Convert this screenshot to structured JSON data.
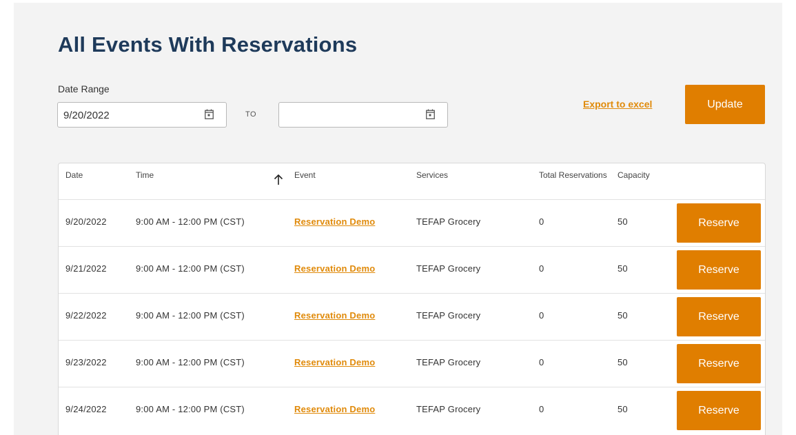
{
  "page_title": "All Events With Reservations",
  "date_range": {
    "label": "Date Range",
    "start_value": "9/20/2022",
    "to_label": "TO",
    "end_value": ""
  },
  "actions": {
    "export_label": "Export to excel",
    "update_label": "Update"
  },
  "table": {
    "headers": {
      "date": "Date",
      "time": "Time",
      "event": "Event",
      "services": "Services",
      "total_reservations": "Total Reservations",
      "capacity": "Capacity"
    },
    "sort_icon": "arrow-up-icon",
    "rows": [
      {
        "date": "9/20/2022",
        "time": "9:00 AM - 12:00 PM (CST)",
        "event": "Reservation Demo",
        "services": "TEFAP Grocery",
        "total": "0",
        "capacity": "50",
        "action": "Reserve"
      },
      {
        "date": "9/21/2022",
        "time": "9:00 AM - 12:00 PM (CST)",
        "event": "Reservation Demo",
        "services": "TEFAP Grocery",
        "total": "0",
        "capacity": "50",
        "action": "Reserve"
      },
      {
        "date": "9/22/2022",
        "time": "9:00 AM - 12:00 PM (CST)",
        "event": "Reservation Demo",
        "services": "TEFAP Grocery",
        "total": "0",
        "capacity": "50",
        "action": "Reserve"
      },
      {
        "date": "9/23/2022",
        "time": "9:00 AM - 12:00 PM (CST)",
        "event": "Reservation Demo",
        "services": "TEFAP Grocery",
        "total": "0",
        "capacity": "50",
        "action": "Reserve"
      },
      {
        "date": "9/24/2022",
        "time": "9:00 AM - 12:00 PM (CST)",
        "event": "Reservation Demo",
        "services": "TEFAP Grocery",
        "total": "0",
        "capacity": "50",
        "action": "Reserve"
      }
    ]
  },
  "colors": {
    "accent": "#e07e00",
    "title": "#1e3a5a",
    "background": "#f3f3f3"
  }
}
